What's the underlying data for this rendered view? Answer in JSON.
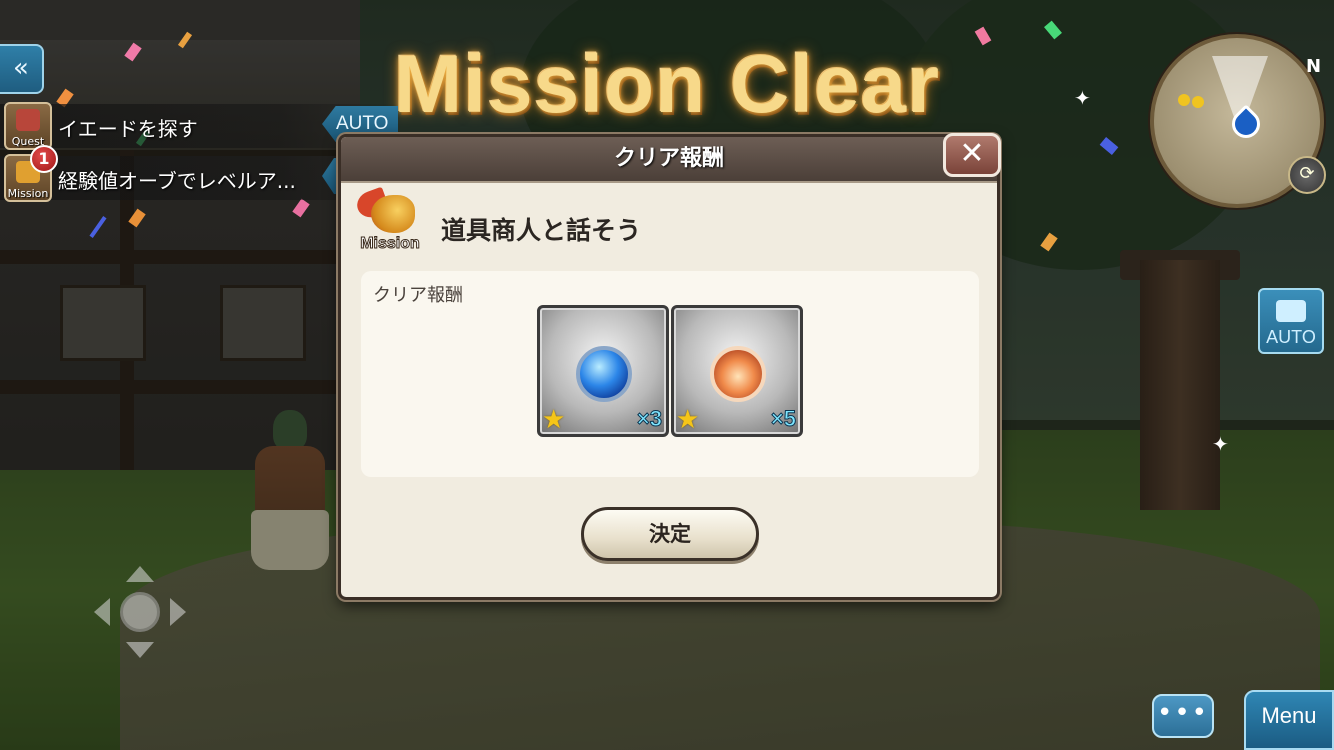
{
  "title": "Mission Clear",
  "quest_panel": {
    "back_icon": "double-chevron-left-icon",
    "rows": [
      {
        "icon_label": "Quest",
        "text": "イエードを探す"
      },
      {
        "icon_label": "Mission",
        "text": "経験値オーブでレベルア..."
      }
    ],
    "badge_count": "1",
    "auto_label": "AUTO"
  },
  "minimap": {
    "north_label": "N"
  },
  "camera_auto_label": "AUTO",
  "menu_label": "Menu",
  "chat_label": "•••",
  "dialog": {
    "title": "クリア報酬",
    "close_label": "✕",
    "mission_icon_label": "Mission",
    "mission_name": "道具商人と話そう",
    "reward_section_label": "クリア報酬",
    "rewards": [
      {
        "icon": "blue-orb-icon",
        "quantity": "×3",
        "rarity_stars": 1
      },
      {
        "icon": "fire-orb-icon",
        "quantity": "×5",
        "rarity_stars": 1
      }
    ],
    "confirm_label": "決定"
  },
  "colors": {
    "title_gold": "#f7d98a",
    "dialog_bg": "#f1ece0",
    "header_bg": "#4b3f38",
    "accent_blue": "#2f86b4",
    "quantity_cyan": "#7fe6ff"
  }
}
